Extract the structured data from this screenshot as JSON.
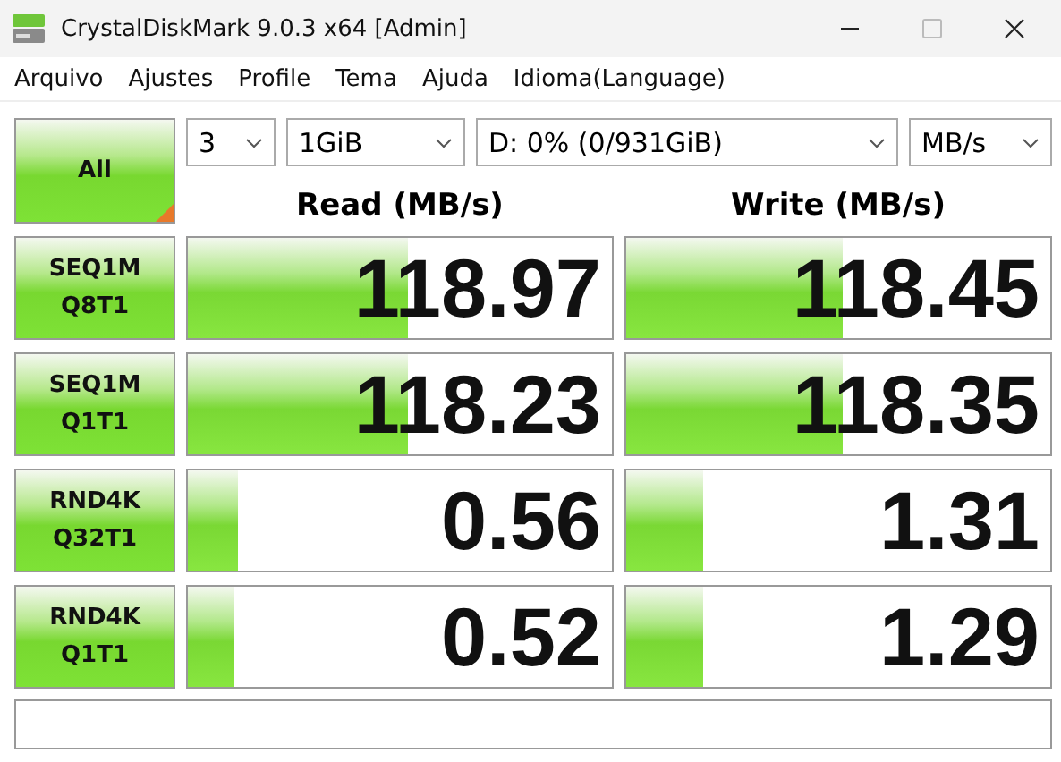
{
  "window": {
    "title": "CrystalDiskMark 9.0.3 x64 [Admin]"
  },
  "menu": [
    "Arquivo",
    "Ajustes",
    "Profile",
    "Tema",
    "Ajuda",
    "Idioma(Language)"
  ],
  "all_button": {
    "label": "All"
  },
  "selectors": [
    {
      "value": "3"
    },
    {
      "value": "1GiB"
    },
    {
      "value": "D: 0% (0/931GiB)"
    },
    {
      "value": "MB/s"
    }
  ],
  "columns": [
    "Read (MB/s)",
    "Write (MB/s)"
  ],
  "tests": [
    {
      "label": [
        "SEQ1M",
        "Q8T1"
      ],
      "read": {
        "value": "118.97",
        "level": 0.52
      },
      "write": {
        "value": "118.45",
        "level": 0.51
      }
    },
    {
      "label": [
        "SEQ1M",
        "Q1T1"
      ],
      "read": {
        "value": "118.23",
        "level": 0.52
      },
      "write": {
        "value": "118.35",
        "level": 0.51
      }
    },
    {
      "label": [
        "RND4K",
        "Q32T1"
      ],
      "read": {
        "value": "0.56",
        "level": 0.12
      },
      "write": {
        "value": "1.31",
        "level": 0.18
      }
    },
    {
      "label": [
        "RND4K",
        "Q1T1"
      ],
      "read": {
        "value": "0.52",
        "level": 0.11
      },
      "write": {
        "value": "1.29",
        "level": 0.18
      }
    }
  ]
}
